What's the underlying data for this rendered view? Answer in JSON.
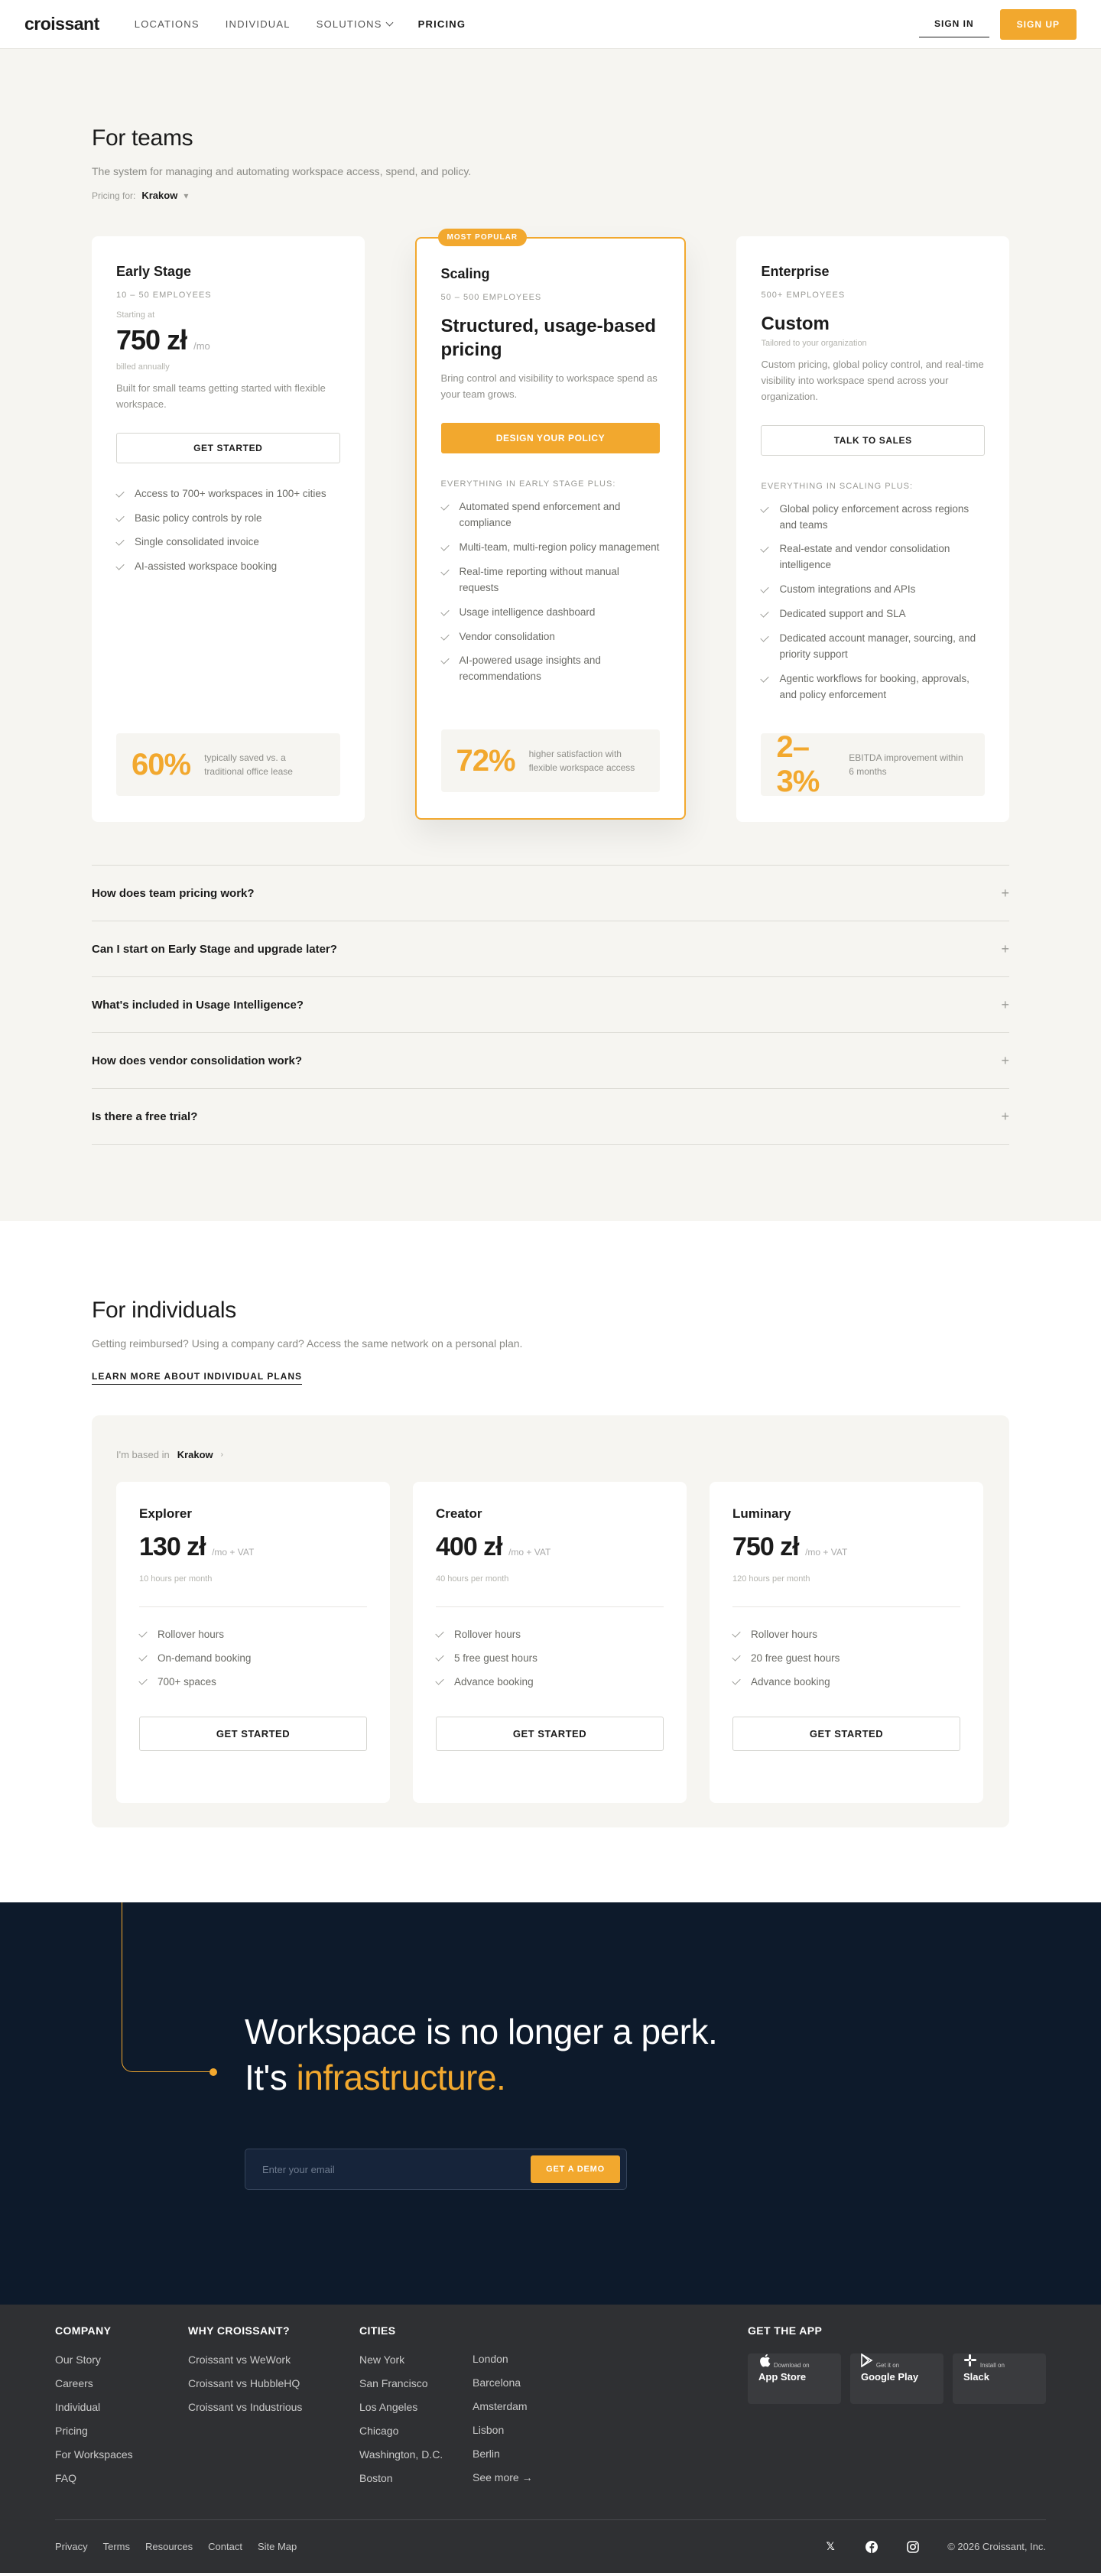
{
  "header": {
    "logo": "croissant",
    "nav": [
      "LOCATIONS",
      "INDIVIDUAL",
      "SOLUTIONS",
      "PRICING"
    ],
    "sign_in": "SIGN IN",
    "sign_up": "SIGN UP"
  },
  "teams": {
    "title": "For teams",
    "subtitle": "The system for managing and automating workspace access, spend, and policy.",
    "pricing_for_label": "Pricing for:",
    "city": "Krakow",
    "plans": [
      {
        "name": "Early Stage",
        "range": "10 – 50 EMPLOYEES",
        "starting": "Starting at",
        "price": "750 zł",
        "per": "/mo",
        "billed": "billed annually",
        "desc": "Built for small teams getting started with flexible workspace.",
        "cta": "GET STARTED",
        "features": [
          "Access to 700+ workspaces in 100+ cities",
          "Basic policy controls by role",
          "Single consolidated invoice",
          "AI-assisted workspace booking"
        ],
        "stat_num": "60%",
        "stat_label": "typically saved vs. a traditional office lease"
      },
      {
        "badge": "MOST POPULAR",
        "name": "Scaling",
        "range": "50 – 500 EMPLOYEES",
        "headline": "Structured, usage-based pricing",
        "desc": "Bring control and visibility to workspace spend as your team grows.",
        "cta": "DESIGN YOUR POLICY",
        "everything": "EVERYTHING IN EARLY STAGE PLUS:",
        "features": [
          "Automated spend enforcement and compliance",
          "Multi-team, multi-region policy management",
          "Real-time reporting without manual requests",
          "Usage intelligence dashboard",
          "Vendor consolidation",
          "AI-powered usage insights and recommendations"
        ],
        "stat_num": "72%",
        "stat_label": "higher satisfaction with flexible workspace access"
      },
      {
        "name": "Enterprise",
        "range": "500+ EMPLOYEES",
        "headline": "Custom",
        "tailored": "Tailored to your organization",
        "desc": "Custom pricing, global policy control, and real-time visibility into workspace spend across your organization.",
        "cta": "TALK TO SALES",
        "everything": "EVERYTHING IN SCALING PLUS:",
        "features": [
          "Global policy enforcement across regions and teams",
          "Real-estate and vendor consolidation intelligence",
          "Custom integrations and APIs",
          "Dedicated support and SLA",
          "Dedicated account manager, sourcing, and priority support",
          "Agentic workflows for booking, approvals, and policy enforcement"
        ],
        "stat_num": "2–3%",
        "stat_label": "EBITDA improvement within 6 months"
      }
    ],
    "faq": [
      "How does team pricing work?",
      "Can I start on Early Stage and upgrade later?",
      "What's included in Usage Intelligence?",
      "How does vendor consolidation work?",
      "Is there a free trial?"
    ]
  },
  "individuals": {
    "title": "For individuals",
    "subtitle": "Getting reimbursed? Using a company card? Access the same network on a personal plan.",
    "learn_more": "LEARN MORE ABOUT INDIVIDUAL PLANS",
    "based_label": "I'm based in",
    "city": "Krakow",
    "plans": [
      {
        "name": "Explorer",
        "price": "130 zł",
        "per": "/mo + VAT",
        "hours": "10 hours per month",
        "features": [
          "Rollover hours",
          "On-demand booking",
          "700+ spaces"
        ],
        "cta": "GET STARTED"
      },
      {
        "name": "Creator",
        "price": "400 zł",
        "per": "/mo + VAT",
        "hours": "40 hours per month",
        "features": [
          "Rollover hours",
          "5 free guest hours",
          "Advance booking"
        ],
        "cta": "GET STARTED"
      },
      {
        "name": "Luminary",
        "price": "750 zł",
        "per": "/mo + VAT",
        "hours": "120 hours per month",
        "features": [
          "Rollover hours",
          "20 free guest hours",
          "Advance booking"
        ],
        "cta": "GET STARTED"
      }
    ]
  },
  "cta": {
    "line1": "Workspace is no longer a perk.",
    "line2_prefix": "It's ",
    "line2_accent": "infrastructure.",
    "email_placeholder": "Enter your email",
    "button": "GET A DEMO"
  },
  "footer": {
    "company": {
      "title": "COMPANY",
      "links": [
        "Our Story",
        "Careers",
        "Individual",
        "Pricing",
        "For Workspaces",
        "FAQ"
      ]
    },
    "why": {
      "title": "WHY CROISSANT?",
      "links": [
        "Croissant vs WeWork",
        "Croissant vs HubbleHQ",
        "Croissant vs Industrious"
      ]
    },
    "cities": {
      "title": "CITIES",
      "col1": [
        "New York",
        "San Francisco",
        "Los Angeles",
        "Chicago",
        "Washington, D.C.",
        "Boston"
      ],
      "col2": [
        "London",
        "Barcelona",
        "Amsterdam",
        "Lisbon",
        "Berlin",
        "See more →"
      ]
    },
    "app": {
      "title": "GET THE APP",
      "stores": [
        {
          "top": "Download on",
          "name": "App Store"
        },
        {
          "top": "Get it on",
          "name": "Google Play"
        },
        {
          "top": "Install on",
          "name": "Slack"
        }
      ]
    },
    "bottom_links": [
      "Privacy",
      "Terms",
      "Resources",
      "Contact",
      "Site Map"
    ],
    "copyright": "© 2026 Croissant, Inc."
  },
  "colors": {
    "accent": "#f2a82e",
    "navy": "#0d1a2b",
    "footer": "#2f3033",
    "cream": "#f6f5f1"
  }
}
